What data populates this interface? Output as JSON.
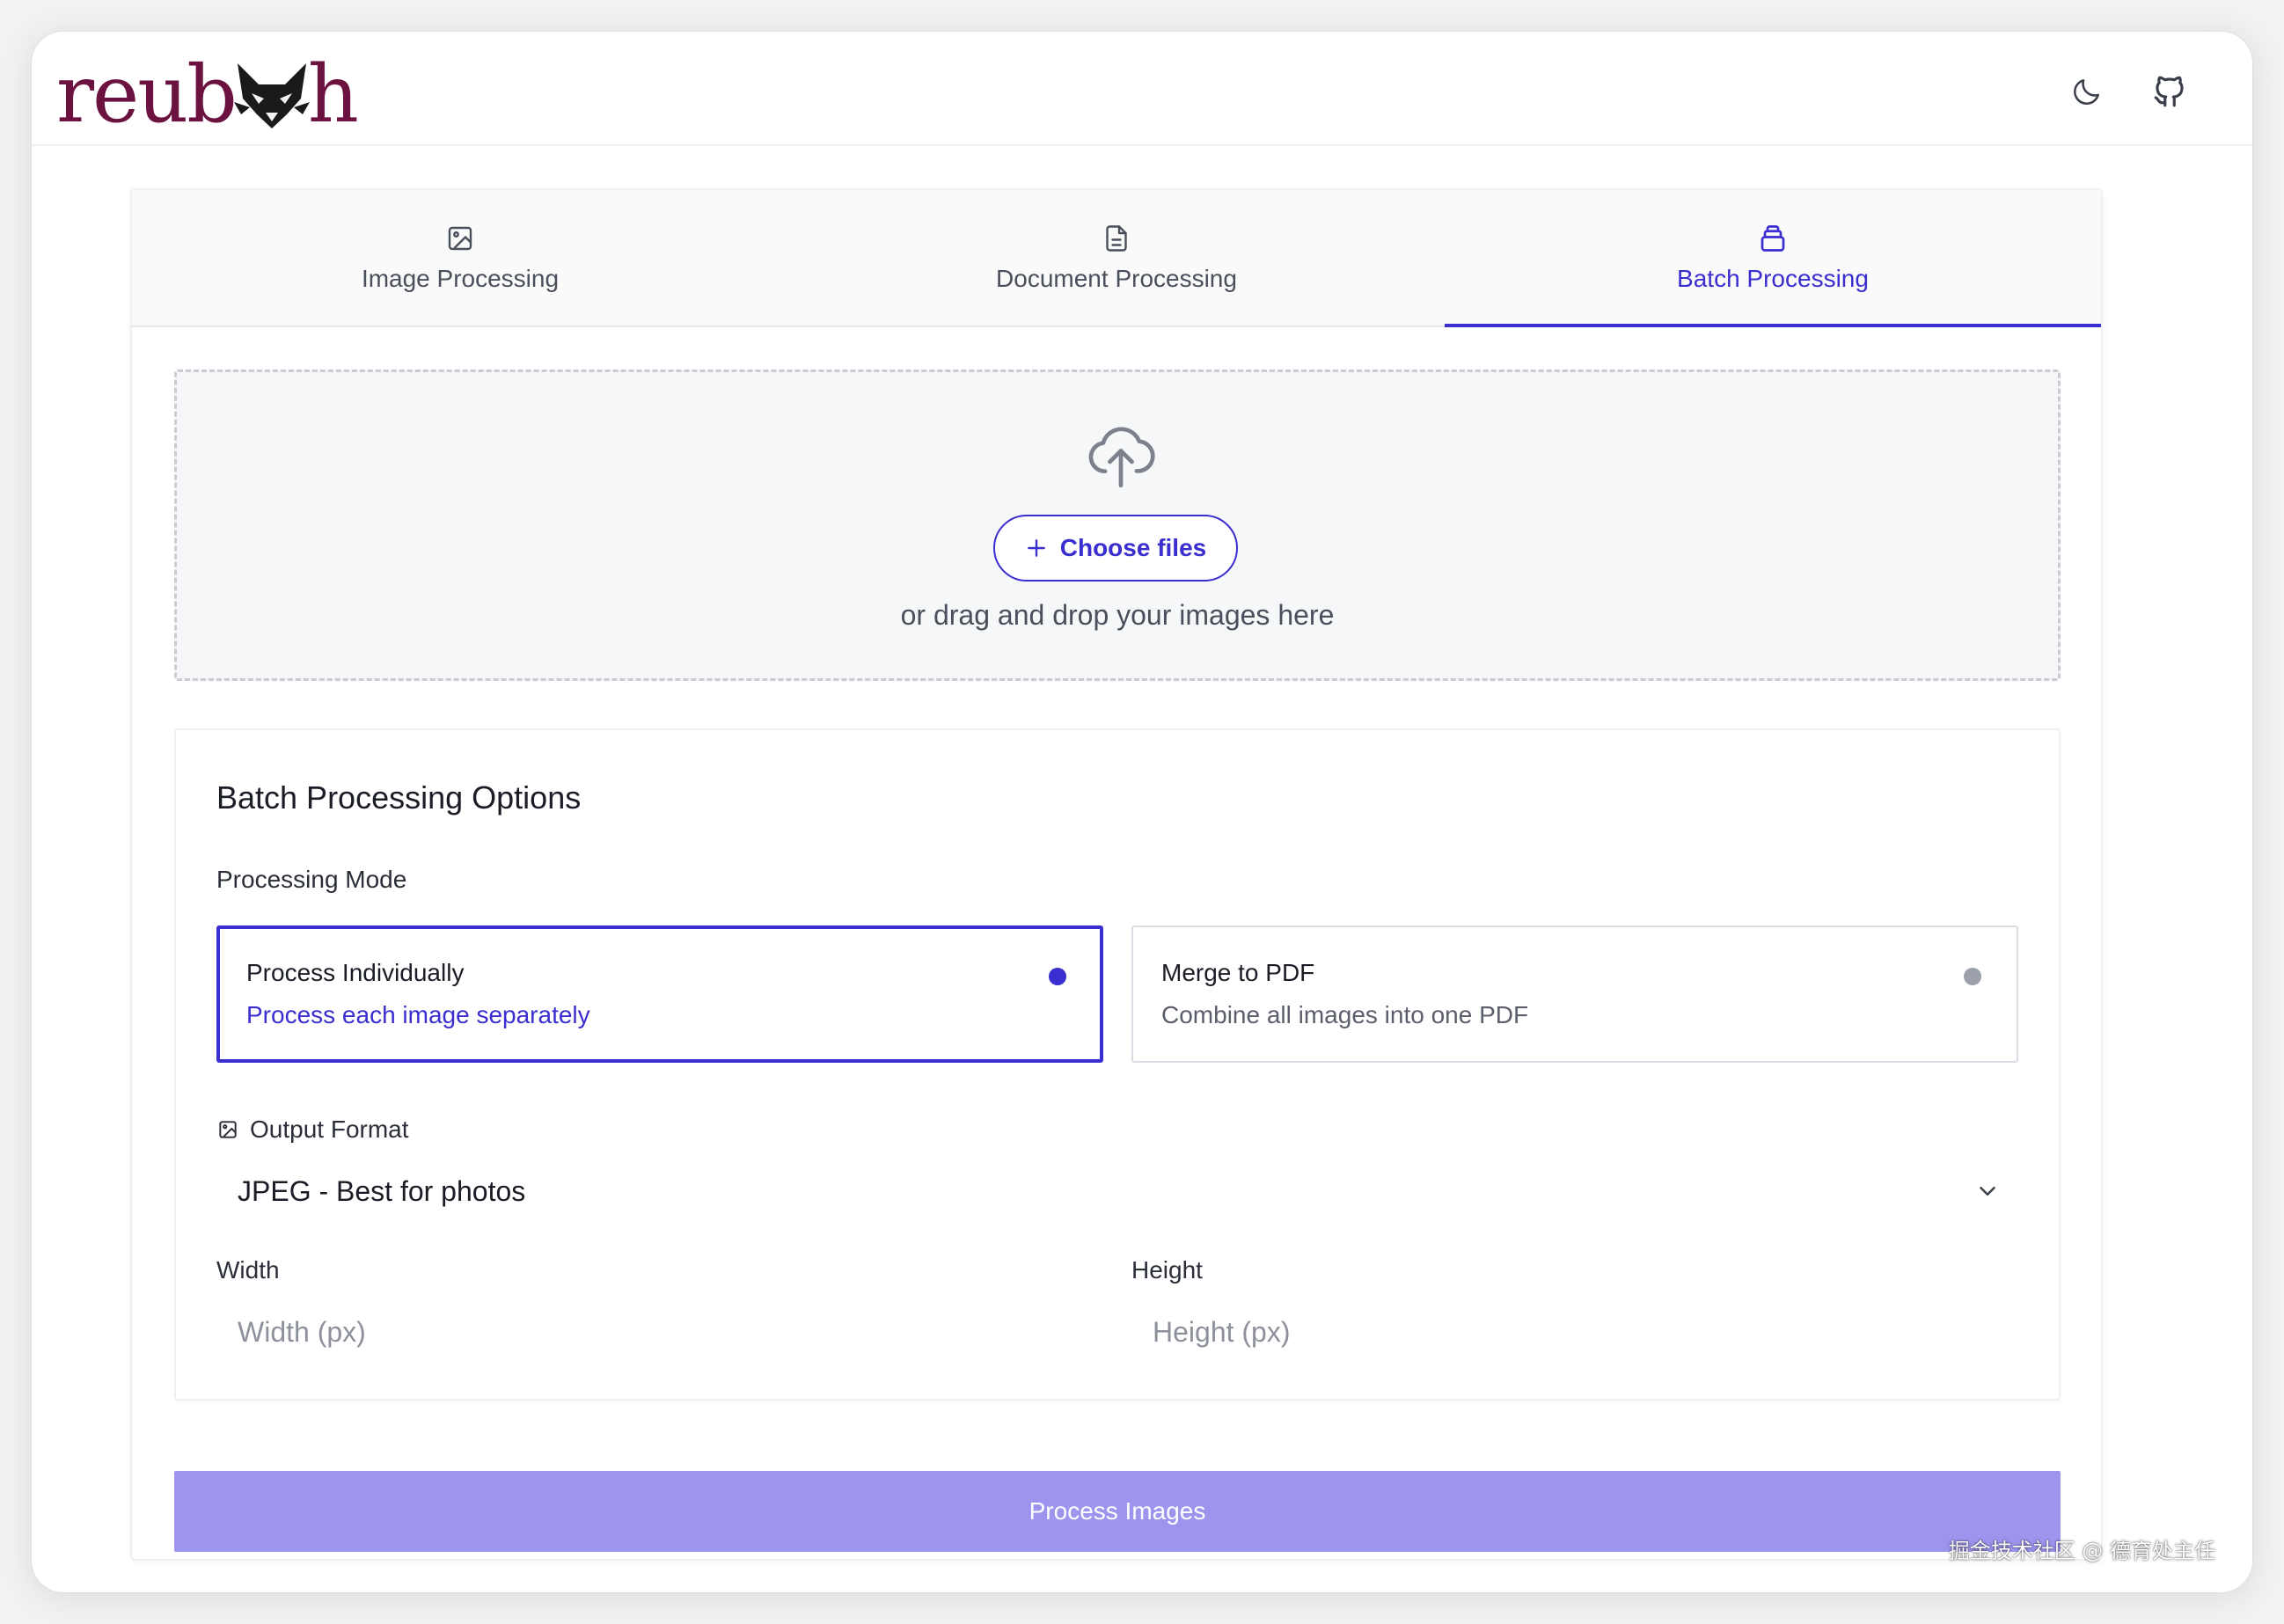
{
  "header": {
    "logo_text_left": "reub",
    "logo_text_right": "h",
    "theme_toggle_icon": "moon-icon",
    "github_icon": "github-icon"
  },
  "tabs": [
    {
      "label": "Image Processing",
      "icon": "image-icon",
      "active": false
    },
    {
      "label": "Document Processing",
      "icon": "document-icon",
      "active": false
    },
    {
      "label": "Batch Processing",
      "icon": "stack-icon",
      "active": true
    }
  ],
  "dropzone": {
    "icon": "cloud-upload-icon",
    "choose_label": "Choose files",
    "hint": "or drag and drop your images here"
  },
  "options": {
    "title": "Batch Processing Options",
    "mode_label": "Processing Mode",
    "modes": [
      {
        "title": "Process Individually",
        "desc": "Process each image separately",
        "selected": true
      },
      {
        "title": "Merge to PDF",
        "desc": "Combine all images into one PDF",
        "selected": false
      }
    ],
    "format_label": "Output Format",
    "format_value": "JPEG - Best for photos",
    "width_label": "Width",
    "width_placeholder": "Width (px)",
    "height_label": "Height",
    "height_placeholder": "Height (px)"
  },
  "process_button": "Process Images",
  "watermark": "掘金技术社区 @ 德育处主任",
  "colors": {
    "accent": "#3b2ed0",
    "logo": "#6b1240",
    "process_button": "#9c94ed"
  }
}
